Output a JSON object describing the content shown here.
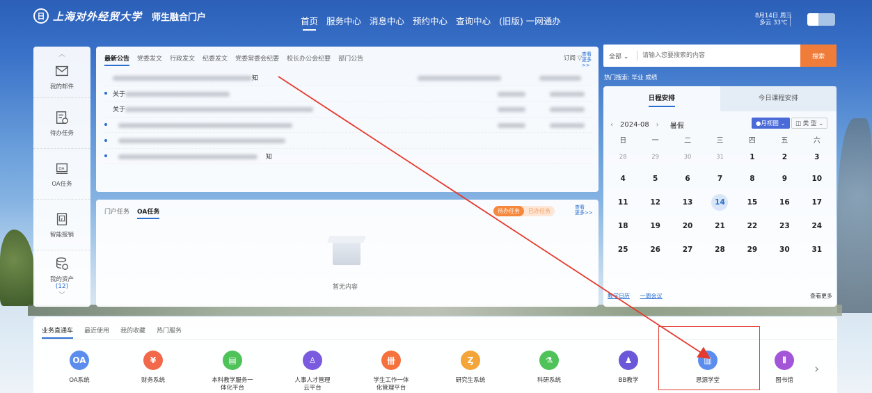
{
  "header": {
    "logo_seal": "日",
    "logo_name": "上海对外经贸大学",
    "logo_sub": "师生融合门户",
    "nav": [
      "首页",
      "服务中心",
      "消息中心",
      "预约中心",
      "查询中心",
      "(旧版) 一网通办"
    ],
    "date_line1": "8月14日 周三",
    "date_line2": "多云 33℃"
  },
  "dock": [
    {
      "label": "我的邮件",
      "icon": "mail-icon"
    },
    {
      "label": "待办任务",
      "icon": "task-icon"
    },
    {
      "label": "OA任务",
      "icon": "oa-icon"
    },
    {
      "label": "智能报销",
      "icon": "receipt-icon"
    },
    {
      "label": "我的资产",
      "icon": "asset-icon",
      "count": "(12)"
    }
  ],
  "announcements": {
    "tabs": [
      "最新公告",
      "党委发文",
      "行政发文",
      "纪委发文",
      "党委常委会纪要",
      "校长办公会纪要",
      "部门公告"
    ],
    "subscribe": "订阅 ▽",
    "more_1": "查看",
    "more_2": "更多>>",
    "rows": [
      {
        "text": "知"
      },
      {
        "text": "关于"
      },
      {
        "text": "关于"
      },
      {
        "text": ""
      },
      {
        "text": ""
      },
      {
        "text": "知"
      }
    ]
  },
  "tasks": {
    "tabs": [
      "门户任务",
      "OA任务"
    ],
    "pill_todo": "待办任务",
    "pill_done": "已办任务",
    "more_1": "查看",
    "more_2": "更多>>",
    "empty": "暂无内容"
  },
  "search": {
    "scope": "全部 ⌄",
    "placeholder": "请输入您要搜索的内容",
    "button": "搜索",
    "hot": "热门搜索:  毕业  成绩"
  },
  "calendar": {
    "tabs": [
      "日程安排",
      "今日课程安排"
    ],
    "prev": "‹",
    "month": "2024-08",
    "next": "›",
    "term": "暑假",
    "view": "●月视图 ⌄",
    "type": "◫ 类 型 ⌄",
    "weekdays": [
      "日",
      "一",
      "二",
      "三",
      "四",
      "五",
      "六"
    ],
    "days": [
      [
        "28",
        "29",
        "30",
        "31",
        "1",
        "2",
        "3"
      ],
      [
        "4",
        "5",
        "6",
        "7",
        "8",
        "9",
        "10"
      ],
      [
        "11",
        "12",
        "13",
        "14",
        "15",
        "16",
        "17"
      ],
      [
        "18",
        "19",
        "20",
        "21",
        "22",
        "23",
        "24"
      ],
      [
        "25",
        "26",
        "27",
        "28",
        "29",
        "30",
        "31"
      ]
    ],
    "today": "14",
    "link1": "教学日历",
    "link2": "一周会议",
    "more": "查看更多"
  },
  "services": {
    "tabs": [
      "业务直通车",
      "最近使用",
      "我的收藏",
      "热门服务"
    ],
    "apps": [
      {
        "label": "OA系统",
        "color": "#5b8def",
        "glyph": "OA"
      },
      {
        "label": "财务系统",
        "color": "#f2684a",
        "glyph": "¥"
      },
      {
        "label": "本科教学服务一体化平台",
        "color": "#4fc25a",
        "glyph": "▤"
      },
      {
        "label": "人事人才管理云平台",
        "color": "#7a5be0",
        "glyph": "♙"
      },
      {
        "label": "学生工作一体化管理平台",
        "color": "#f5713d",
        "glyph": "卌"
      },
      {
        "label": "研究生系统",
        "color": "#f3a53a",
        "glyph": "Ȥ"
      },
      {
        "label": "科研系统",
        "color": "#4fc25a",
        "glyph": "⚗"
      },
      {
        "label": "BB教学",
        "color": "#6a58d8",
        "glyph": "♟"
      },
      {
        "label": "思源学堂",
        "color": "#5b8def",
        "glyph": "▥"
      },
      {
        "label": "图书馆",
        "color": "#a355d8",
        "glyph": "⫴"
      }
    ],
    "next": "›"
  }
}
